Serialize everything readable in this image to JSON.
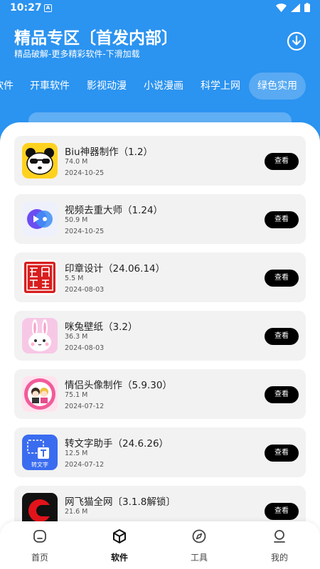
{
  "status_bar": {
    "time": "10:27",
    "notification_glyph": "A"
  },
  "header": {
    "title": "精品专区〔首发内部〕",
    "subtitle": "精品破解-更多精彩软件-下滑加载",
    "download_icon": "download-icon"
  },
  "tabs": [
    {
      "label": "软件"
    },
    {
      "label": "开車软件"
    },
    {
      "label": "影视动漫"
    },
    {
      "label": "小说漫画"
    },
    {
      "label": "科学上网"
    },
    {
      "label": "绿色实用",
      "active": true
    }
  ],
  "apps": [
    {
      "name": "Biu神器制作（1.2）",
      "size": "74.0 M",
      "date": "2024-10-25",
      "button": "查看",
      "icon": "panda-icon"
    },
    {
      "name": "视频去重大师（1.24）",
      "size": "50.9 M",
      "date": "2024-10-25",
      "button": "查看",
      "icon": "video-dedupe-icon"
    },
    {
      "name": "印章设计（24.06.14）",
      "size": "5.5 M",
      "date": "2024-08-03",
      "button": "查看",
      "icon": "seal-icon"
    },
    {
      "name": "咪兔壁纸（3.2）",
      "size": "36.3 M",
      "date": "2024-08-03",
      "button": "查看",
      "icon": "bunny-icon"
    },
    {
      "name": "情侣头像制作（5.9.30）",
      "size": "75.1 M",
      "date": "2024-07-12",
      "button": "查看",
      "icon": "couple-avatar-icon"
    },
    {
      "name": "转文字助手（24.6.26）",
      "size": "12.5 M",
      "date": "2024-07-12",
      "button": "查看",
      "icon": "text-convert-icon",
      "icon_text": "转文字"
    },
    {
      "name": "网飞猫全网〔3.1.8解锁〕",
      "size": "21.6 M",
      "date": "",
      "button": "查看",
      "icon": "netcat-icon"
    }
  ],
  "bottom_nav": [
    {
      "label": "首页",
      "icon": "home-icon"
    },
    {
      "label": "软件",
      "icon": "cube-icon",
      "active": true
    },
    {
      "label": "工具",
      "icon": "compass-icon"
    },
    {
      "label": "我的",
      "icon": "user-icon"
    }
  ],
  "colors": {
    "header_bg": "#2b93f0",
    "card_bg": "#f2f2f2",
    "button_bg": "#000000"
  }
}
